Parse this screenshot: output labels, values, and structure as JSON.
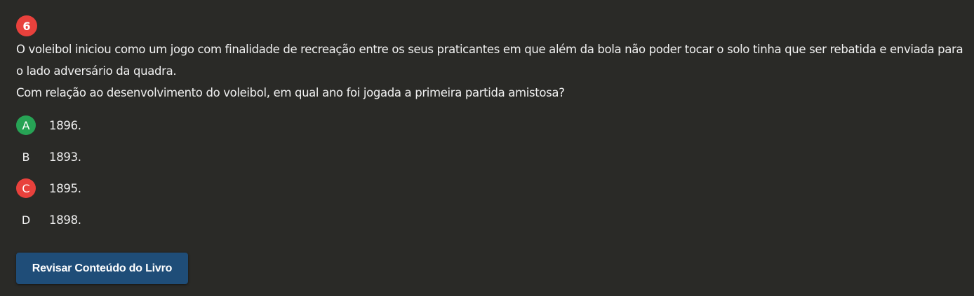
{
  "question": {
    "number": "6",
    "number_color": "#e8413c",
    "statement_lines": [
      "O voleibol iniciou como um jogo com finalidade de recreação entre os seus praticantes em que além da bola não poder tocar o solo tinha que ser rebatida e enviada para o lado adversário da quadra.",
      "Com relação ao desenvolvimento do voleibol, em qual ano foi jogada a primeira partida amistosa?"
    ]
  },
  "options": [
    {
      "letter": "A",
      "text": "1896.",
      "status": "correct",
      "color": "#27a355"
    },
    {
      "letter": "B",
      "text": "1893.",
      "status": "none"
    },
    {
      "letter": "C",
      "text": "1895.",
      "status": "wrong",
      "color": "#e8413c"
    },
    {
      "letter": "D",
      "text": "1898.",
      "status": "none"
    }
  ],
  "review_button": {
    "label": "Revisar Conteúdo do Livro",
    "color": "#1f4d78"
  }
}
